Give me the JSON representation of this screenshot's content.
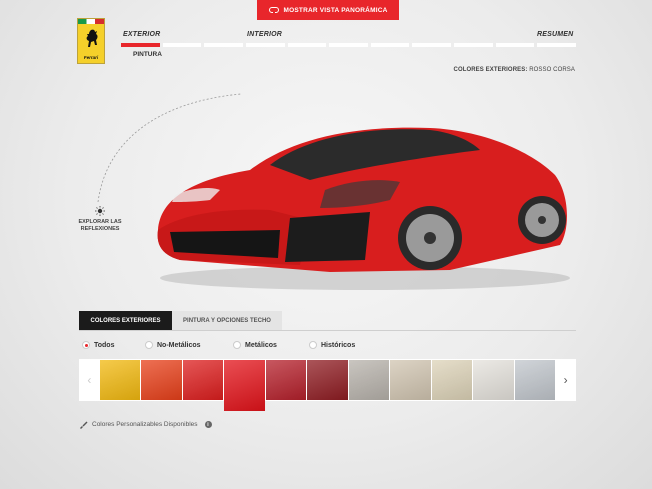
{
  "header": {
    "panorama_button": "MOSTRAR VISTA PANORÁMICA",
    "panorama_icon": "vr-headset-icon"
  },
  "logo": {
    "word": "Ferrari",
    "icon": "prancing-horse-icon"
  },
  "steps": {
    "items": [
      {
        "label": "EXTERIOR"
      },
      {
        "label": "INTERIOR"
      },
      {
        "label": "RESUMEN"
      }
    ],
    "sub_label": "PINTURA",
    "bar_count": 11,
    "active_bar": 0
  },
  "color_info": {
    "label": "COLORES EXTERIORES:",
    "value": "ROSSO CORSA"
  },
  "reflections": {
    "label_line1": "EXPLORAR LAS",
    "label_line2": "REFLEXIONES",
    "icon": "sun-icon"
  },
  "tabs": [
    {
      "label": "COLORES EXTERIORES",
      "active": true
    },
    {
      "label": "PINTURA Y OPCIONES TECHO",
      "active": false
    }
  ],
  "filters": [
    {
      "label": "Todos",
      "selected": true
    },
    {
      "label": "No-Metálicos",
      "selected": false
    },
    {
      "label": "Metálicos",
      "selected": false
    },
    {
      "label": "Históricos",
      "selected": false
    }
  ],
  "swatches": {
    "prev_icon": "chevron-left-icon",
    "next_icon": "chevron-right-icon",
    "colors": [
      "#f2b90f",
      "#e8401a",
      "#dd1e1e",
      "#e3131a",
      "#b5202b",
      "#8f1c22",
      "#b7b2ab",
      "#d1c5b1",
      "#ddd3b8",
      "#e5e2dc",
      "#c1c6cc"
    ],
    "selected_index": 3
  },
  "custom": {
    "label": "Colores Personalizables Disponibles",
    "icon": "paint-brush-icon",
    "info_icon": "info-icon"
  },
  "accent_color": "#e8262b"
}
